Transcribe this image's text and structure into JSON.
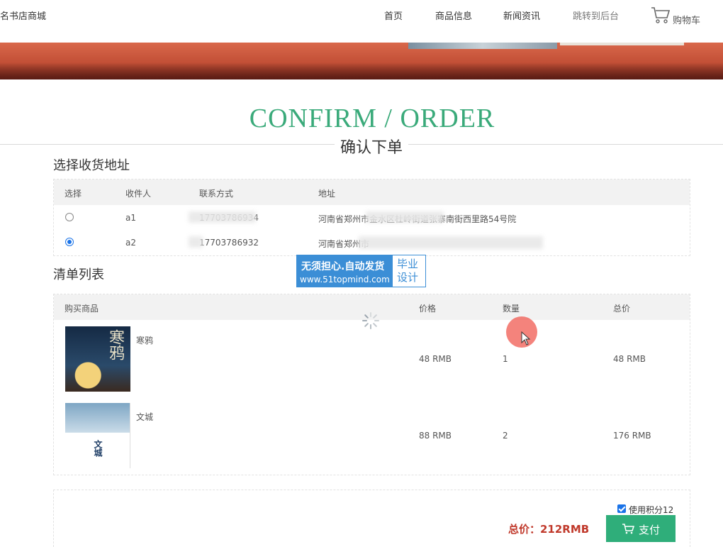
{
  "header": {
    "brand": "名书店商城",
    "nav": [
      {
        "label": "首页"
      },
      {
        "label": "商品信息"
      },
      {
        "label": "新闻资讯"
      },
      {
        "label": "跳转到后台"
      }
    ],
    "cart_label": "购物车"
  },
  "titles": {
    "en": "CONFIRM / ORDER",
    "cn": "确认下单"
  },
  "address": {
    "section_title": "选择收货地址",
    "columns": [
      "选择",
      "收件人",
      "联系方式",
      "地址"
    ],
    "rows": [
      {
        "selected": false,
        "name": "a1",
        "phone": "17703786934",
        "address": "河南省郑州市金水区杜岭街道张寨南街西里路54号院"
      },
      {
        "selected": true,
        "name": "a2",
        "phone": "17703786932",
        "address": "河南省郑州市"
      }
    ]
  },
  "watermark": {
    "line1": "无须担心.自动发货",
    "line2": "www.51topmind.com",
    "right": "毕业设计"
  },
  "list": {
    "section_title": "清单列表",
    "columns": [
      "购买商品",
      "价格",
      "数量",
      "总价"
    ],
    "items": [
      {
        "name": "寒鸦",
        "price": "48 RMB",
        "qty": "1",
        "total": "48 RMB",
        "cover_title": "寒鸦"
      },
      {
        "name": "文城",
        "price": "88 RMB",
        "qty": "2",
        "total": "176 RMB",
        "cover_title": "文城"
      }
    ]
  },
  "footer": {
    "points_label": "使用积分12",
    "points_checked": true,
    "total": "总价：212RMB",
    "pay_label": "支付"
  },
  "colors": {
    "accent_green": "#3aaa7a",
    "pay_green": "#2fae7a",
    "total_red": "#c0392b",
    "radio_blue": "#1a73e8"
  }
}
